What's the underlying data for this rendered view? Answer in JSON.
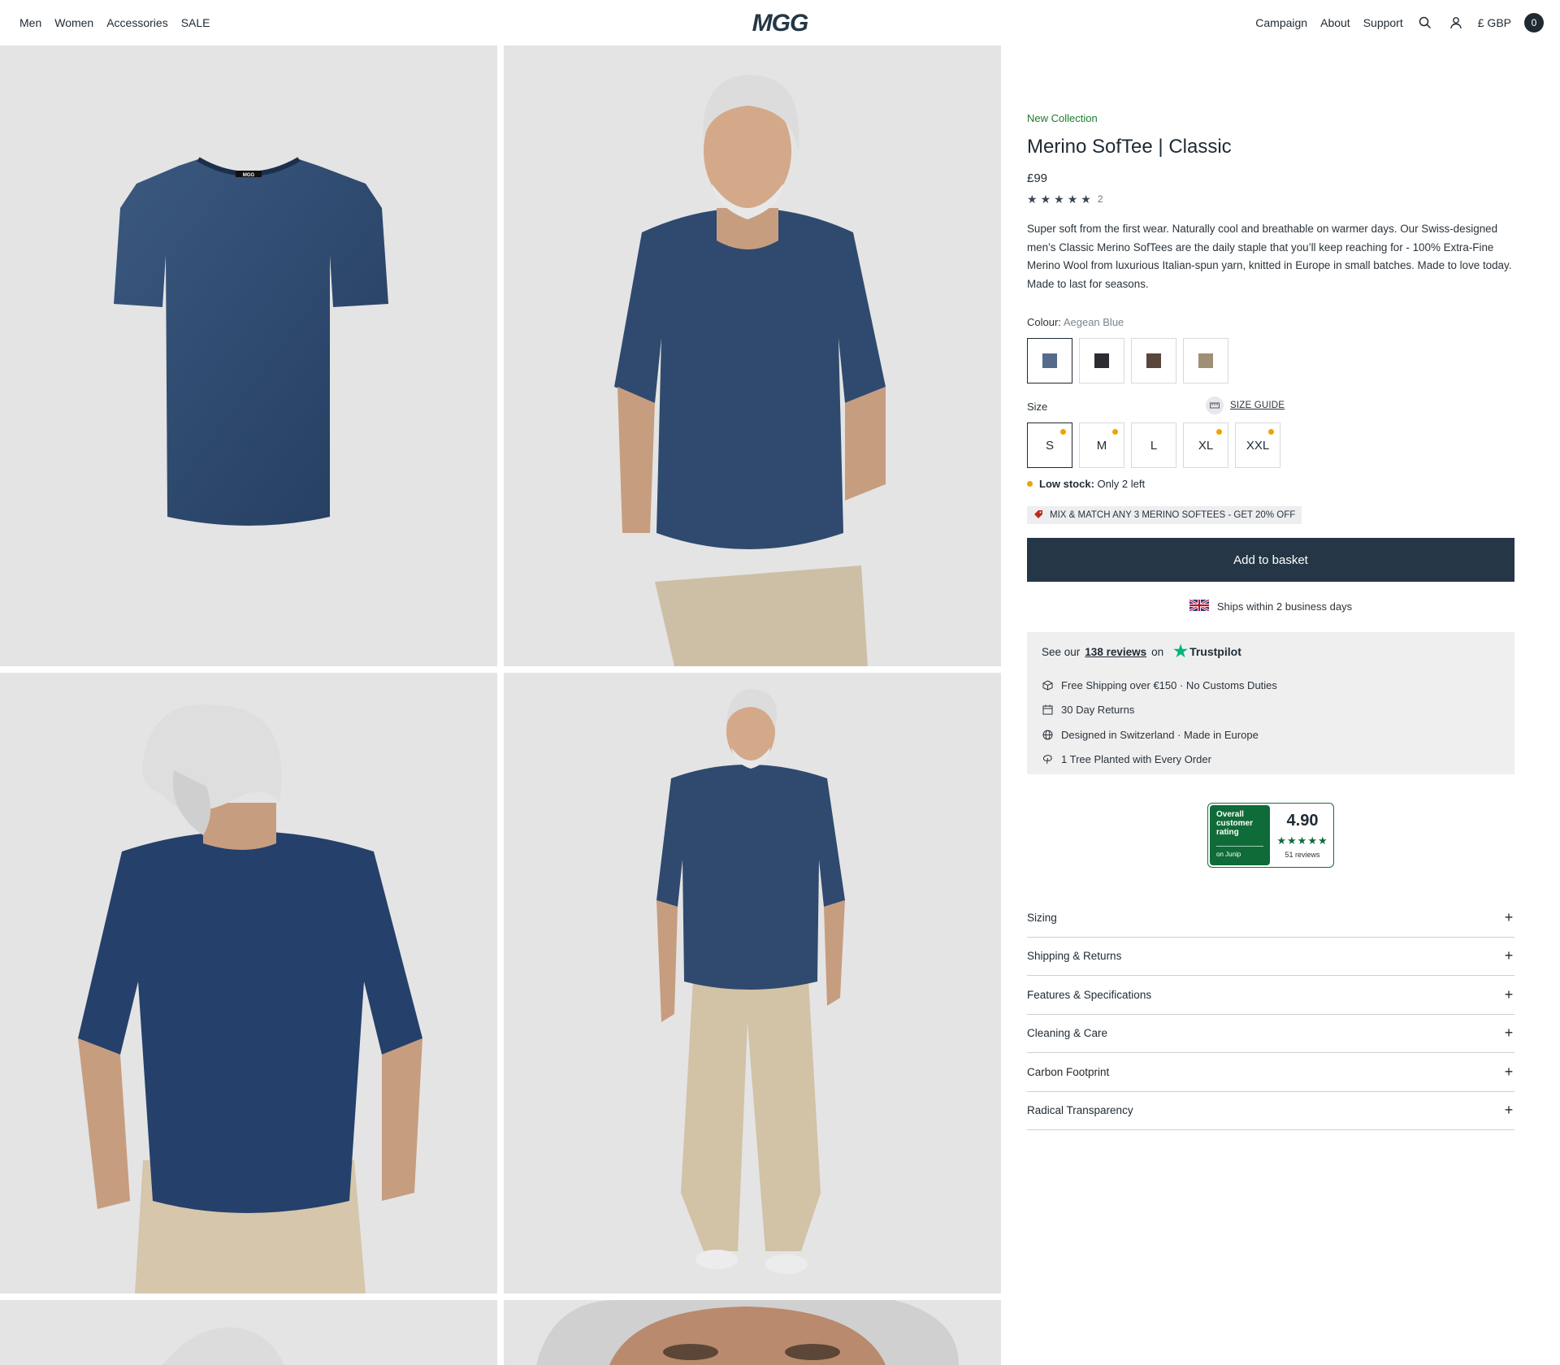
{
  "header": {
    "nav_left": [
      "Men",
      "Women",
      "Accessories",
      "SALE"
    ],
    "logo_text": "MGG",
    "nav_right": [
      "Campaign",
      "About",
      "Support"
    ],
    "currency": "£ GBP",
    "cart_count": "0"
  },
  "product": {
    "eyebrow": "New Collection",
    "title": "Merino SofTee | Classic",
    "price": "£99",
    "rating_stars": 5,
    "review_count": "2",
    "description": "Super soft from the first wear. Naturally cool and breathable on warmer days. Our Swiss-designed men’s Classic Merino SofTees are the daily staple that you’ll keep reaching for - 100% Extra-Fine Merino Wool from luxurious Italian-spun yarn, knitted in Europe in small batches. Made to love today. Made to last for seasons.",
    "colour_label": "Colour:",
    "colour_value": "Aegean Blue",
    "colours": [
      {
        "color": "#556b8c",
        "selected": true
      },
      {
        "color": "#2c2d30",
        "selected": false
      },
      {
        "color": "#5b463c",
        "selected": false
      },
      {
        "color": "#a08f74",
        "selected": false
      }
    ],
    "size_label": "Size",
    "size_guide": "SIZE GUIDE",
    "sizes": [
      {
        "label": "S",
        "low_stock": true,
        "selected": true
      },
      {
        "label": "M",
        "low_stock": true,
        "selected": false
      },
      {
        "label": "L",
        "low_stock": false,
        "selected": false
      },
      {
        "label": "XL",
        "low_stock": true,
        "selected": false
      },
      {
        "label": "XXL",
        "low_stock": true,
        "selected": false
      }
    ],
    "stock_bold": "Low stock:",
    "stock_text": "Only 2 left",
    "promo": "MIX & MATCH ANY 3 MERINO SOFTEES - GET 20% OFF",
    "add_to_basket": "Add to basket",
    "ships": "Ships within 2 business days"
  },
  "usp": {
    "trust_prefix": "See our",
    "trust_link": "138 reviews",
    "trust_on": "on",
    "trustpilot": "Trustpilot",
    "items": [
      {
        "icon": "box-icon",
        "text": "Free Shipping over €150 · No Customs Duties"
      },
      {
        "icon": "calendar-icon",
        "text": "30 Day Returns"
      },
      {
        "icon": "globe-icon",
        "text": "Designed in Switzerland · Made in Europe"
      },
      {
        "icon": "tree-icon",
        "text": "1 Tree Planted with Every Order"
      }
    ]
  },
  "junip": {
    "title": "Overall customer rating",
    "on": "on Junip",
    "score": "4.90",
    "reviews": "51 reviews",
    "stars": 4.9
  },
  "accordion": [
    "Sizing",
    "Shipping & Returns",
    "Features & Specifications",
    "Cleaning & Care",
    "Carbon Footprint",
    "Radical Transparency"
  ],
  "colors": {
    "accent_green": "#1d7a2d",
    "button_dark": "#253746",
    "low_stock_dot": "#f0a200",
    "tile_bg": "#e4e4e4",
    "shirt_navy": "#2f4a6e"
  }
}
